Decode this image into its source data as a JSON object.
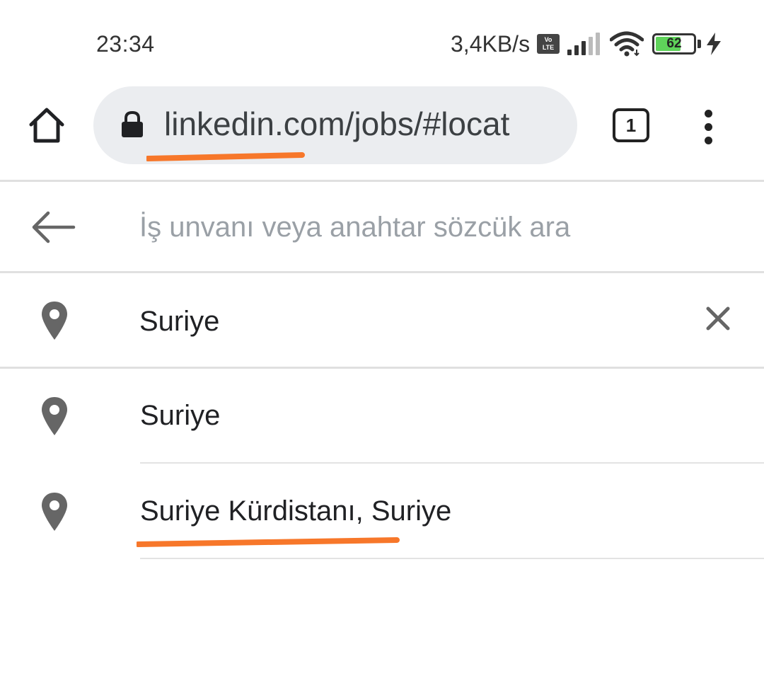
{
  "status_bar": {
    "time": "23:34",
    "net_speed": "3,4KB/s",
    "volte_line1": "Vo",
    "volte_line2": "LTE",
    "battery_level": "62",
    "battery_percent": 62,
    "battery_color": "#5fd35a",
    "icons": [
      "volte-icon",
      "signal-icon",
      "wifi-icon",
      "battery-icon",
      "charging-bolt-icon"
    ]
  },
  "browser": {
    "url": "linkedin.com/jobs/#locat",
    "tab_count": "1",
    "icons": [
      "home-icon",
      "lock-icon",
      "tab-switcher-icon",
      "overflow-menu-icon"
    ]
  },
  "search": {
    "placeholder": "İş unvanı veya anahtar sözcük ara",
    "value": ""
  },
  "location": {
    "value": "Suriye",
    "icons": [
      "location-pin-icon",
      "clear-icon"
    ]
  },
  "suggestions": [
    {
      "label": "Suriye"
    },
    {
      "label": "Suriye Kürdistanı, Suriye"
    }
  ],
  "annotations": {
    "highlight_color": "#f7772a"
  }
}
